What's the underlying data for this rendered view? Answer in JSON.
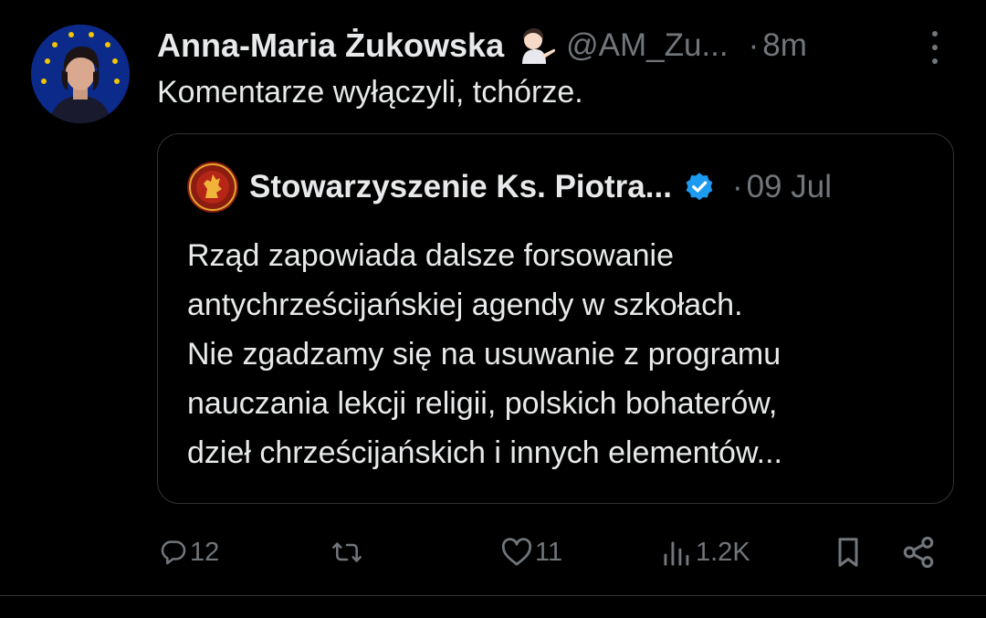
{
  "post": {
    "author_name": "Anna-Maria Żukowska",
    "author_handle": "@AM_Zu...",
    "separator": "·",
    "time": "8m",
    "text": "Komentarze wyłączyli, tchórze."
  },
  "quoted_post": {
    "author_name": "Stowarzyszenie Ks. Piotra...",
    "separator": "·",
    "time": "09 Jul",
    "text_lines": [
      "Rząd zapowiada dalsze forsowanie",
      "antychrześcijańskiej agendy w szkołach.",
      "Nie zgadzamy się na usuwanie z programu",
      "nauczania lekcji religii, polskich bohaterów,",
      "dzieł chrześcijańskich i innych elementów..."
    ],
    "verified": true
  },
  "actions": {
    "replies": "12",
    "reposts": "",
    "likes": "11",
    "views": "1.2K"
  },
  "icons": {
    "more": "more-vertical-icon",
    "reply": "reply-icon",
    "repost": "repost-icon",
    "like": "heart-icon",
    "views": "views-chart-icon",
    "bookmark": "bookmark-icon",
    "share": "share-icon",
    "verified": "verified-badge-icon",
    "emoji": "person-tipping-hand-emoji"
  },
  "colors": {
    "background": "#000000",
    "text": "#e7e9ea",
    "muted": "#71767b",
    "border": "#2f3336",
    "verified": "#1d9bf0"
  }
}
